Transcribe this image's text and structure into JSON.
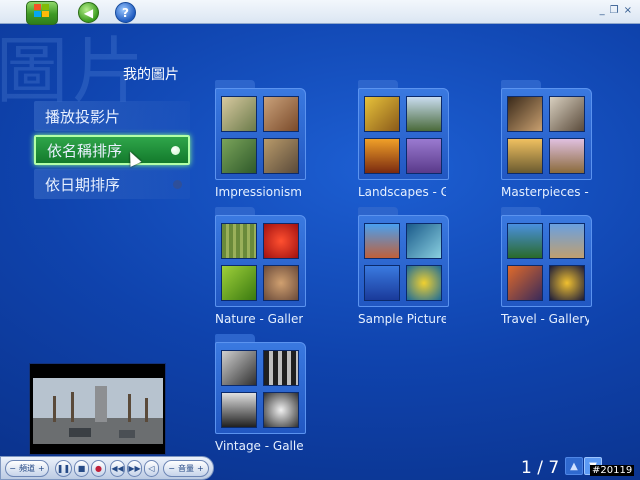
{
  "toolbar": {
    "start_icon": "windows-logo-icon",
    "back_icon": "back-arrow-icon",
    "help_label": "?",
    "minimize": "_",
    "restore": "❐",
    "close": "×"
  },
  "watermark": "圖片",
  "page_title": "我的圖片",
  "menu": {
    "items": [
      {
        "label": "播放投影片"
      },
      {
        "label": "依名稱排序"
      },
      {
        "label": "依日期排序"
      }
    ]
  },
  "folders": [
    {
      "label": "Impressionism"
    },
    {
      "label": "Landscapes - G"
    },
    {
      "label": "Masterpieces -"
    },
    {
      "label": "Nature - Galler"
    },
    {
      "label": "Sample Picture"
    },
    {
      "label": "Travel - Gallery"
    },
    {
      "label": "Vintage - Galle"
    }
  ],
  "transport": {
    "channel_label": "頻道",
    "volume_label": "音量"
  },
  "pager": {
    "text": "1 / 7"
  },
  "corner_id": "#20119",
  "colors": {
    "accent_green": "#2fa64a",
    "background_blue": "#0f43ad"
  }
}
